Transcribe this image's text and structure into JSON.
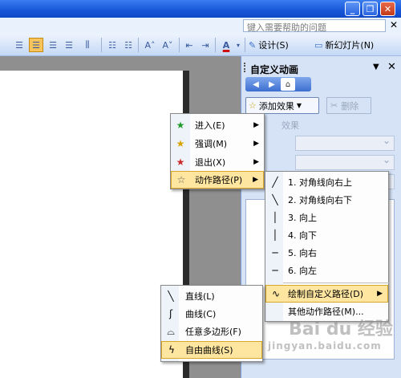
{
  "window": {
    "min": "_",
    "max": "❐",
    "close": "✕"
  },
  "help": {
    "placeholder": "键入需要帮助的问题",
    "close": "✕"
  },
  "toolbar": {
    "font_increase": "A˄",
    "font_decrease": "A˅",
    "font_color": "A",
    "design_label": "设计(S)",
    "new_slide_label": "新幻灯片(N)"
  },
  "taskpane": {
    "title": "自定义动画",
    "dropdown": "▼",
    "close": "✕",
    "add_effect": "添加效果",
    "delete": "删除",
    "effect_label": "效果",
    "list_char": "1"
  },
  "menu1": {
    "items": [
      {
        "label": "进入(E)",
        "icon": "entrance-star-icon"
      },
      {
        "label": "强调(M)",
        "icon": "emphasis-star-icon"
      },
      {
        "label": "退出(X)",
        "icon": "exit-star-icon"
      },
      {
        "label": "动作路径(P)",
        "icon": "motion-path-star-icon"
      }
    ]
  },
  "menu2": {
    "items": [
      {
        "label": "1. 对角线向右上",
        "icon": "diagonal-up-right-icon"
      },
      {
        "label": "2. 对角线向右下",
        "icon": "diagonal-down-right-icon"
      },
      {
        "label": "3. 向上",
        "icon": "up-line-icon"
      },
      {
        "label": "4. 向下",
        "icon": "down-line-icon"
      },
      {
        "label": "5. 向右",
        "icon": "right-line-icon"
      },
      {
        "label": "6. 向左",
        "icon": "left-line-icon"
      },
      {
        "label": "绘制自定义路径(D)",
        "icon": "draw-custom-path-icon"
      },
      {
        "label": "其他动作路径(M)...",
        "icon": ""
      }
    ]
  },
  "menu3": {
    "items": [
      {
        "label": "直线(L)",
        "icon": "straight-line-icon"
      },
      {
        "label": "曲线(C)",
        "icon": "curve-icon"
      },
      {
        "label": "任意多边形(F)",
        "icon": "freeform-polygon-icon"
      },
      {
        "label": "自由曲线(S)",
        "icon": "scribble-icon"
      }
    ]
  },
  "watermark": {
    "text": "Bai du 经验",
    "sub": "jingyan.baidu.com"
  }
}
